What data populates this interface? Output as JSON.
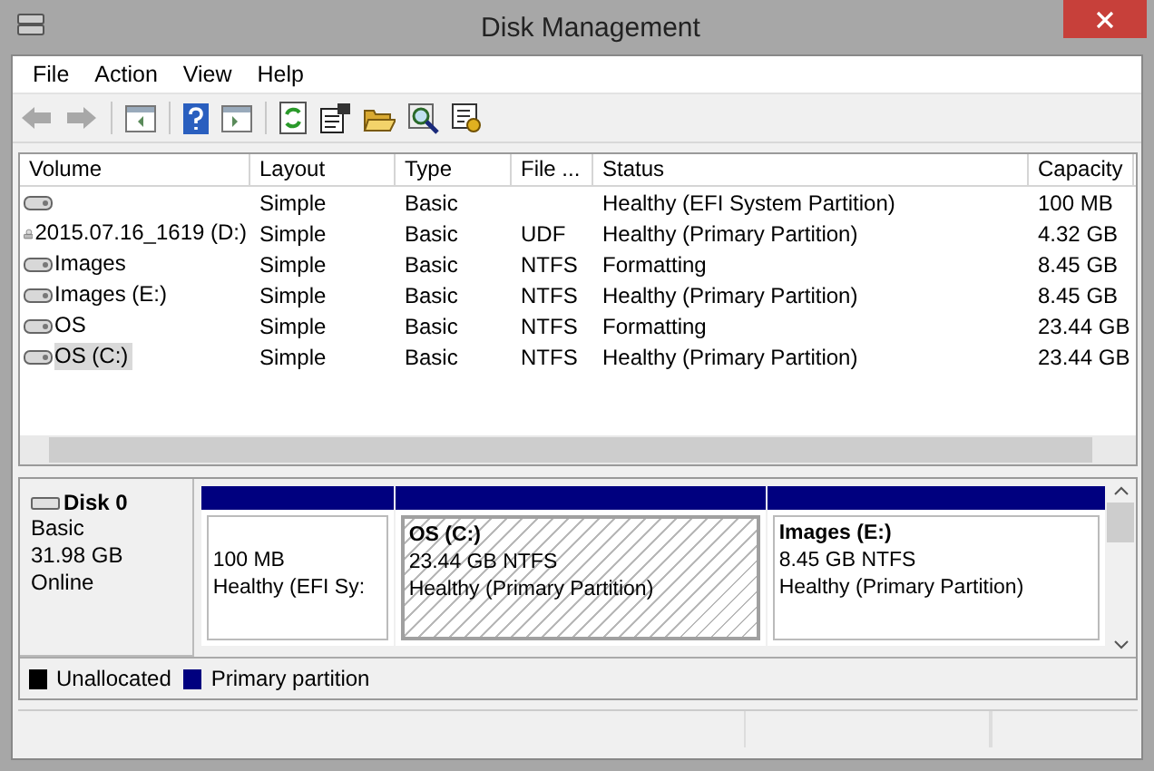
{
  "window": {
    "title": "Disk Management"
  },
  "menu": [
    "File",
    "Action",
    "View",
    "Help"
  ],
  "toolbar": [
    {
      "kind": "back",
      "disabled": true
    },
    {
      "kind": "forward",
      "disabled": true
    },
    {
      "kind": "sep"
    },
    {
      "kind": "tree",
      "disabled": false
    },
    {
      "kind": "sep"
    },
    {
      "kind": "help",
      "disabled": false
    },
    {
      "kind": "pane",
      "disabled": false
    },
    {
      "kind": "sep"
    },
    {
      "kind": "refresh",
      "disabled": false
    },
    {
      "kind": "properties",
      "disabled": false
    },
    {
      "kind": "open",
      "disabled": false
    },
    {
      "kind": "find",
      "disabled": false
    },
    {
      "kind": "settings",
      "disabled": false
    }
  ],
  "table": {
    "columns": [
      "Volume",
      "Layout",
      "Type",
      "File ...",
      "Status",
      "Capacity"
    ],
    "rows": [
      {
        "kind": "drive",
        "selected": false,
        "cells": [
          "",
          "Simple",
          "Basic",
          "",
          "Healthy (EFI System Partition)",
          "100 MB"
        ]
      },
      {
        "kind": "disc",
        "selected": false,
        "cells": [
          "2015.07.16_1619 (D:)",
          "Simple",
          "Basic",
          "UDF",
          "Healthy (Primary Partition)",
          "4.32 GB"
        ]
      },
      {
        "kind": "drive",
        "selected": false,
        "cells": [
          "Images",
          "Simple",
          "Basic",
          "NTFS",
          "Formatting",
          "8.45 GB"
        ]
      },
      {
        "kind": "drive",
        "selected": false,
        "cells": [
          "Images (E:)",
          "Simple",
          "Basic",
          "NTFS",
          "Healthy (Primary Partition)",
          "8.45 GB"
        ]
      },
      {
        "kind": "drive",
        "selected": false,
        "cells": [
          "OS",
          "Simple",
          "Basic",
          "NTFS",
          "Formatting",
          "23.44 GB"
        ]
      },
      {
        "kind": "drive",
        "selected": true,
        "cells": [
          "OS (C:)",
          "Simple",
          "Basic",
          "NTFS",
          "Healthy (Primary Partition)",
          "23.44 GB"
        ]
      }
    ]
  },
  "disk": {
    "name": "Disk 0",
    "type": "Basic",
    "size": "31.98 GB",
    "state": "Online",
    "partitions": [
      {
        "selected": false,
        "lines": [
          "100 MB",
          "Healthy (EFI Sy:"
        ]
      },
      {
        "selected": true,
        "title": "OS  (C:)",
        "lines": [
          "23.44 GB NTFS",
          "Healthy (Primary Partition)"
        ]
      },
      {
        "selected": false,
        "title": "Images  (E:)",
        "lines": [
          "8.45 GB NTFS",
          "Healthy (Primary Partition)"
        ]
      }
    ]
  },
  "legend": [
    {
      "label": "Unallocated",
      "color": "#000000"
    },
    {
      "label": "Primary partition",
      "color": "#00007f"
    }
  ]
}
